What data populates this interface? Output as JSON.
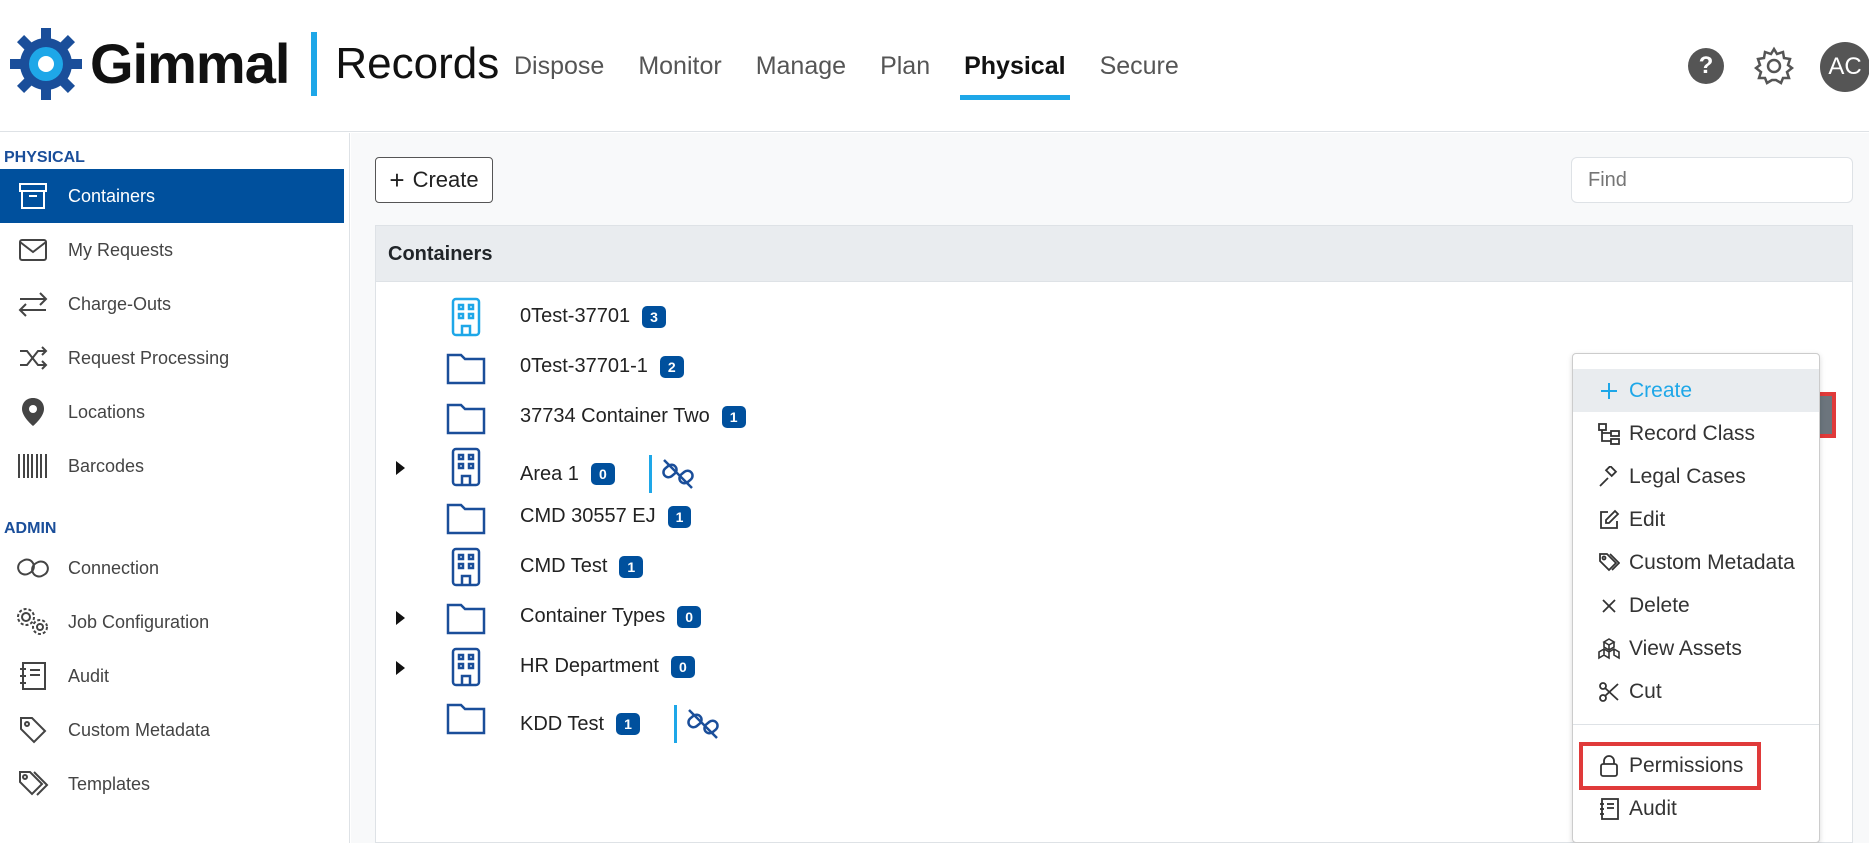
{
  "header": {
    "brand": "Gimmal",
    "product": "Records",
    "nav": [
      {
        "label": "Dispose",
        "active": false
      },
      {
        "label": "Monitor",
        "active": false
      },
      {
        "label": "Manage",
        "active": false
      },
      {
        "label": "Plan",
        "active": false
      },
      {
        "label": "Physical",
        "active": true
      },
      {
        "label": "Secure",
        "active": false
      }
    ],
    "help_label": "?",
    "avatar_initials": "AC"
  },
  "sidebar": {
    "physical_label": "PHYSICAL",
    "physical_items": [
      {
        "label": "Containers",
        "icon": "archive-box-icon",
        "active": true
      },
      {
        "label": "My Requests",
        "icon": "envelope-icon",
        "active": false
      },
      {
        "label": "Charge-Outs",
        "icon": "arrows-left-right-icon",
        "active": false
      },
      {
        "label": "Request Processing",
        "icon": "shuffle-icon",
        "active": false
      },
      {
        "label": "Locations",
        "icon": "map-pin-icon",
        "active": false
      },
      {
        "label": "Barcodes",
        "icon": "barcode-icon",
        "active": false
      }
    ],
    "admin_label": "ADMIN",
    "admin_items": [
      {
        "label": "Connection",
        "icon": "link-icon"
      },
      {
        "label": "Job Configuration",
        "icon": "gears-icon"
      },
      {
        "label": "Audit",
        "icon": "journal-icon"
      },
      {
        "label": "Custom Metadata",
        "icon": "tag-icon"
      },
      {
        "label": "Templates",
        "icon": "tags-icon"
      }
    ]
  },
  "toolbar": {
    "create_label": "Create",
    "find_placeholder": "Find"
  },
  "panel": {
    "title": "Containers",
    "rows": [
      {
        "label": "0Test-37701",
        "count": "3",
        "icon": "building-icon",
        "expandable": false,
        "unlinked": false,
        "selected": true
      },
      {
        "label": "0Test-37701-1",
        "count": "2",
        "icon": "folder-icon",
        "expandable": false,
        "unlinked": false
      },
      {
        "label": "37734 Container Two",
        "count": "1",
        "icon": "folder-icon",
        "expandable": false,
        "unlinked": false
      },
      {
        "label": "Area 1",
        "count": "0",
        "icon": "building-icon",
        "expandable": true,
        "unlinked": true
      },
      {
        "label": "CMD 30557 EJ",
        "count": "1",
        "icon": "folder-icon",
        "expandable": false,
        "unlinked": false
      },
      {
        "label": "CMD Test",
        "count": "1",
        "icon": "building-icon",
        "expandable": false,
        "unlinked": false
      },
      {
        "label": "Container Types",
        "count": "0",
        "icon": "folder-icon",
        "expandable": true,
        "unlinked": false
      },
      {
        "label": "HR Department",
        "count": "0",
        "icon": "building-icon",
        "expandable": true,
        "unlinked": false
      },
      {
        "label": "KDD Test",
        "count": "1",
        "icon": "folder-icon",
        "expandable": false,
        "unlinked": true
      }
    ]
  },
  "menu": {
    "items": [
      {
        "label": "Create",
        "icon": "plus-icon",
        "highlight": true
      },
      {
        "label": "Record Class",
        "icon": "diagram-icon"
      },
      {
        "label": "Legal Cases",
        "icon": "hammer-icon"
      },
      {
        "label": "Edit",
        "icon": "pencil-square-icon"
      },
      {
        "label": "Custom Metadata",
        "icon": "tags-icon"
      },
      {
        "label": "Delete",
        "icon": "x-icon"
      },
      {
        "label": "View Assets",
        "icon": "boxes-icon"
      },
      {
        "label": "Cut",
        "icon": "scissors-icon"
      },
      {
        "label": "Permissions",
        "icon": "lock-icon",
        "annotated": true
      },
      {
        "label": "Audit",
        "icon": "journal-icon"
      }
    ]
  },
  "colors": {
    "accent": "#1ea7e8",
    "active_nav_bg": "#00509d",
    "badge_bg": "#00509d",
    "annotation": "#e03a3a"
  }
}
